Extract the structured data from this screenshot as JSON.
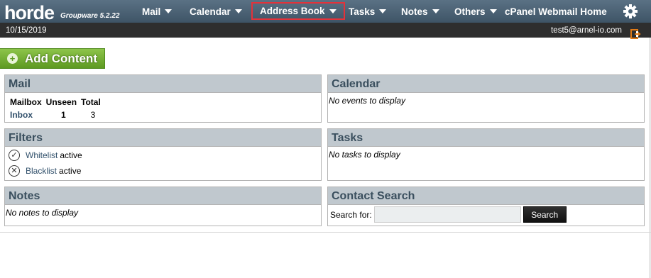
{
  "app": {
    "brand": "horde",
    "version": "Groupware 5.2.22"
  },
  "nav": {
    "items": [
      {
        "label": "Mail"
      },
      {
        "label": "Calendar"
      },
      {
        "label": "Address Book"
      },
      {
        "label": "Tasks"
      },
      {
        "label": "Notes"
      },
      {
        "label": "Others"
      },
      {
        "label": "cPanel Webmail Home"
      }
    ],
    "highlighted": "Address Book",
    "highlight_color": "#e3323a",
    "settings_icon": "gear-icon"
  },
  "subbar": {
    "date": "10/15/2019",
    "user_email": "test5@arnel-io.com",
    "logout_icon": "logout-icon"
  },
  "add_content": {
    "label": "Add Content",
    "icon": "plus-icon",
    "color": "#6fad2e"
  },
  "panels": {
    "mail": {
      "title": "Mail",
      "columns": [
        "Mailbox",
        "Unseen",
        "Total"
      ],
      "rows": [
        {
          "mailbox": "Inbox",
          "unseen": "1",
          "total": "3"
        }
      ]
    },
    "calendar": {
      "title": "Calendar",
      "empty": "No events to display"
    },
    "filters": {
      "title": "Filters",
      "items": [
        {
          "name": "Whitelist",
          "status": "active",
          "icon": "check-circle-icon"
        },
        {
          "name": "Blacklist",
          "status": "active",
          "icon": "x-circle-icon"
        }
      ]
    },
    "tasks": {
      "title": "Tasks",
      "empty": "No tasks to display"
    },
    "notes": {
      "title": "Notes",
      "empty": "No notes to display"
    },
    "contact_search": {
      "title": "Contact Search",
      "label": "Search for:",
      "value": "",
      "button": "Search"
    }
  }
}
